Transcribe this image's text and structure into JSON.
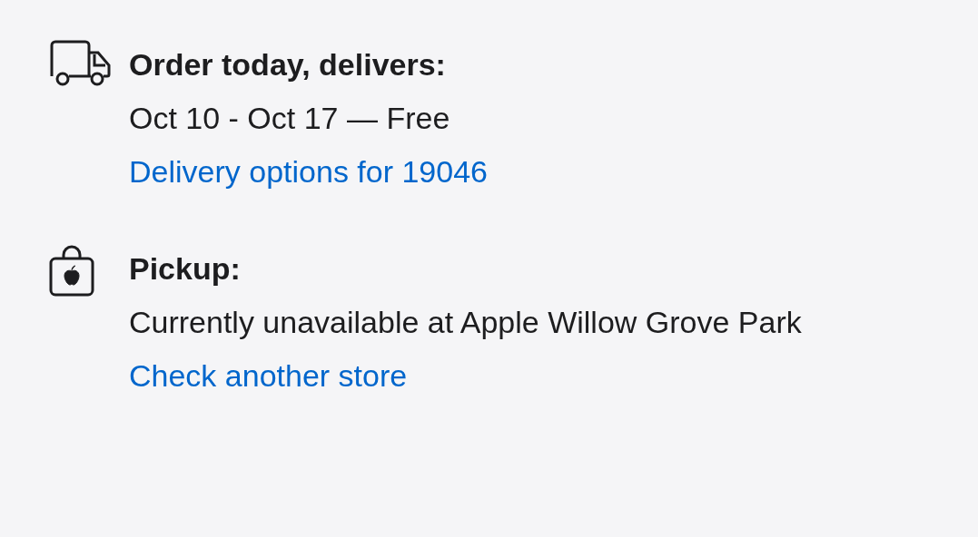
{
  "sections": [
    {
      "kind": "delivery",
      "heading": "Order today, delivers:",
      "detail": "Oct 10 - Oct 17 — Free",
      "link": "Delivery options for 19046"
    },
    {
      "kind": "pickup",
      "heading": "Pickup:",
      "detail": "Currently unavailable at Apple Willow Grove Park",
      "link": "Check another store"
    }
  ]
}
